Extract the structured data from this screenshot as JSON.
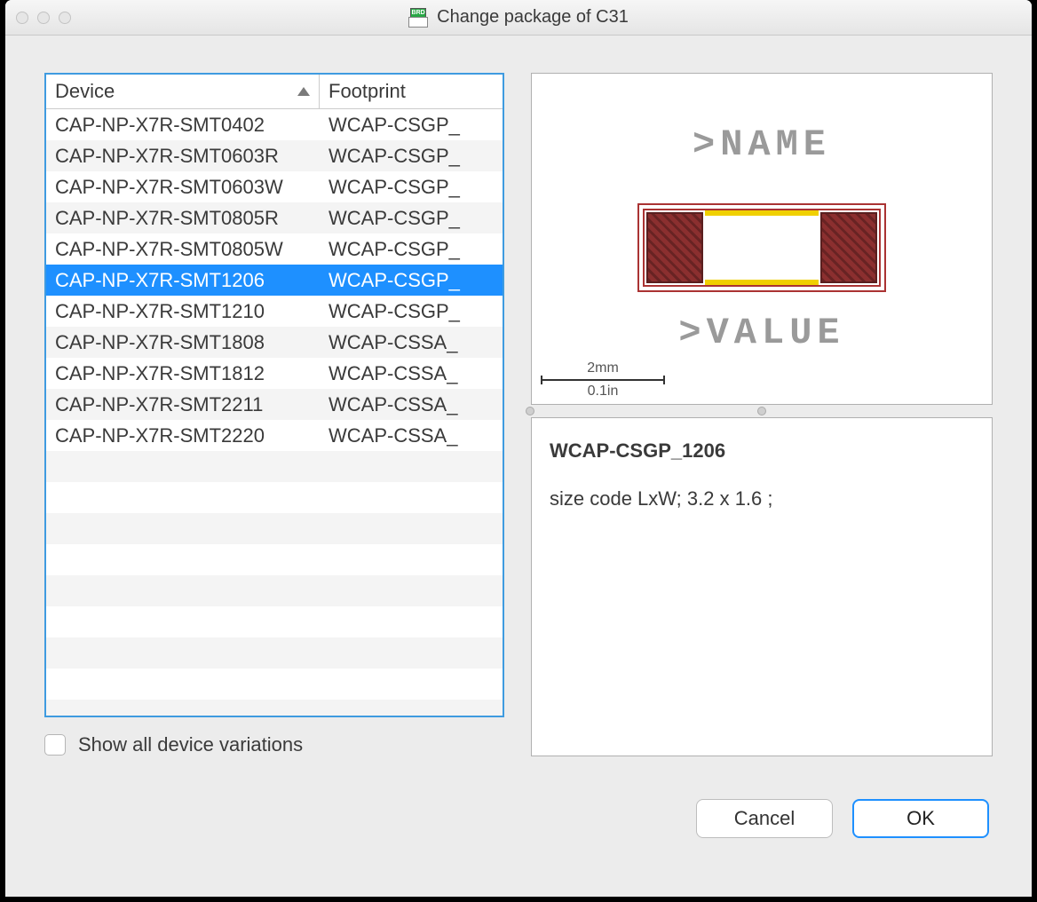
{
  "window": {
    "title": "Change package of C31",
    "brd_badge": "BRD"
  },
  "columns": {
    "device": "Device",
    "footprint": "Footprint"
  },
  "rows": [
    {
      "device": "CAP-NP-X7R-SMT0402",
      "footprint": "WCAP-CSGP_",
      "selected": false
    },
    {
      "device": "CAP-NP-X7R-SMT0603R",
      "footprint": "WCAP-CSGP_",
      "selected": false
    },
    {
      "device": "CAP-NP-X7R-SMT0603W",
      "footprint": "WCAP-CSGP_",
      "selected": false
    },
    {
      "device": "CAP-NP-X7R-SMT0805R",
      "footprint": "WCAP-CSGP_",
      "selected": false
    },
    {
      "device": "CAP-NP-X7R-SMT0805W",
      "footprint": "WCAP-CSGP_",
      "selected": false
    },
    {
      "device": "CAP-NP-X7R-SMT1206",
      "footprint": "WCAP-CSGP_",
      "selected": true
    },
    {
      "device": "CAP-NP-X7R-SMT1210",
      "footprint": "WCAP-CSGP_",
      "selected": false
    },
    {
      "device": "CAP-NP-X7R-SMT1808",
      "footprint": "WCAP-CSSA_",
      "selected": false
    },
    {
      "device": "CAP-NP-X7R-SMT1812",
      "footprint": "WCAP-CSSA_",
      "selected": false
    },
    {
      "device": "CAP-NP-X7R-SMT2211",
      "footprint": "WCAP-CSSA_",
      "selected": false
    },
    {
      "device": "CAP-NP-X7R-SMT2220",
      "footprint": "WCAP-CSSA_",
      "selected": false
    }
  ],
  "checkbox": {
    "label": "Show all device variations",
    "checked": false
  },
  "preview": {
    "name_text": ">NAME",
    "value_text": ">VALUE",
    "scale_mm": "2mm",
    "scale_in": "0.1in"
  },
  "description": {
    "title": "WCAP-CSGP_1206",
    "body": "size code LxW; 3.2 x 1.6 ;"
  },
  "buttons": {
    "cancel": "Cancel",
    "ok": "OK"
  }
}
